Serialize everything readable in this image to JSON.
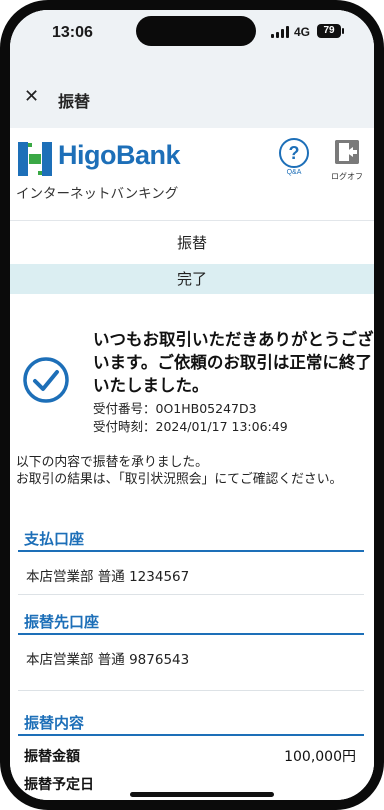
{
  "status_bar": {
    "time": "13:06",
    "network": "4G",
    "battery": "79"
  },
  "nav": {
    "title": "振替"
  },
  "brand": {
    "name": "HigoBank",
    "tagline": "インターネットバンキング",
    "qa_label": "Q&A",
    "logout_label": "ログオフ"
  },
  "steps": {
    "current_section": "振替",
    "status": "完了"
  },
  "completion": {
    "message": "いつもお取引いただきありがとうございます。ご依頼のお取引は正常に終了いたしました。",
    "receipt_number": "受付番号：0O1HB05247D3",
    "receipt_time": "受付時刻：2024/01/17 13:06:49"
  },
  "description": "以下の内容で振替を承りました。\nお取引の結果は、「取引状況照会」にてご確認ください。",
  "payment_account": {
    "heading": "支払口座",
    "value": "本店営業部 普通 1234567"
  },
  "destination_account": {
    "heading": "振替先口座",
    "value": "本店営業部 普通 9876543"
  },
  "transfer_details": {
    "heading": "振替内容",
    "amount_label": "振替金額",
    "amount_value": "100,000円",
    "next_label": "振替予定日"
  },
  "colors": {
    "accent": "#1d6fb8",
    "band": "#dbeef2",
    "logo_green": "#3aa845"
  },
  "icons": [
    "close-icon",
    "question-icon",
    "logout-icon",
    "check-circle-icon"
  ]
}
